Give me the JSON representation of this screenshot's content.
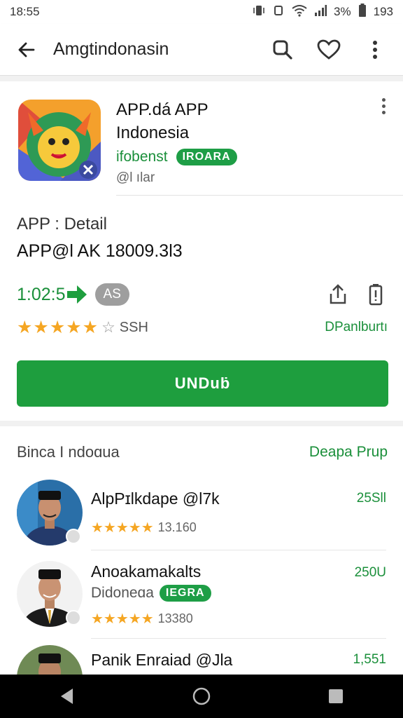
{
  "status_bar": {
    "time": "18:55",
    "right_text": "3%",
    "right_extra": "193",
    "icons": [
      "vibrate-icon",
      "rotate-icon",
      "wifi-icon",
      "signal-icon",
      "battery-icon"
    ]
  },
  "app_bar": {
    "title": "Amgtindonasin",
    "icons": [
      "back-arrow-icon",
      "search-icon",
      "heart-icon",
      "more-vert-icon"
    ]
  },
  "app": {
    "name_line1": "APP.dá APP",
    "name_line2": "Indonesia",
    "developer": "ifobenst",
    "badge": "IROARA",
    "sub_tag": "@l ılar"
  },
  "detail": {
    "label": "APP : Detail",
    "version": "APP@l AK 18009.3l3"
  },
  "meta": {
    "size": "1:02:5",
    "pill": "AS",
    "icons": [
      "share-icon",
      "battery-outline-icon"
    ]
  },
  "rating": {
    "stars": "★★★★★",
    "empty_star": "☆",
    "count": "SSH",
    "link": "DPanlburtı"
  },
  "install_button": "UNDuḃ",
  "similar": {
    "title": "Binca I ndoɑua",
    "more": "Deapa Prup",
    "items": [
      {
        "name": "AlpPɪlkdape @l7k",
        "stars": "★★★★★",
        "count": "13.160",
        "size": "25Sll",
        "sub": "",
        "badge": ""
      },
      {
        "name": "Anoakamakalts",
        "sub": "Didoneɑa",
        "badge": "IEGRA",
        "stars": "★★★★★",
        "count": "13380",
        "size": "250U"
      },
      {
        "name": "Panik Enraiad @Jla",
        "stars": "",
        "count": "",
        "size": "1,551",
        "sub": "",
        "badge": ""
      }
    ]
  },
  "colors": {
    "accent_green": "#1e9e3e",
    "star_gold": "#f5a623",
    "nav_bar": "#000000"
  }
}
